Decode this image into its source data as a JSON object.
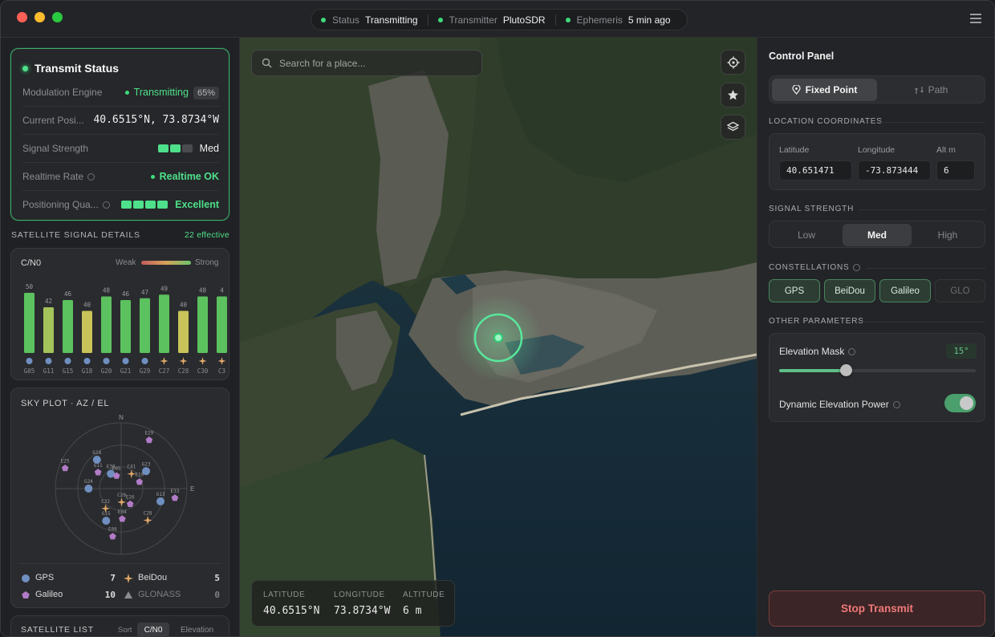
{
  "titlebar": {
    "status_label": "Status",
    "status_value": "Transmitting",
    "transmitter_label": "Transmitter",
    "transmitter_value": "PlutoSDR",
    "ephemeris_label": "Ephemeris",
    "ephemeris_value": "5 min ago"
  },
  "transmit": {
    "title": "Transmit Status",
    "modulation_label": "Modulation Engine",
    "modulation_value": "Transmitting",
    "modulation_progress": "65%",
    "position_label": "Current Posi...",
    "position_value": "40.6515°N, 73.8734°W",
    "signal_label": "Signal Strength",
    "signal_value": "Med",
    "signal_level": 2,
    "rate_label": "Realtime Rate",
    "rate_value": "Realtime OK",
    "quality_label": "Positioning Qua...",
    "quality_value": "Excellent",
    "quality_level": 4
  },
  "satellite_details": {
    "title": "SATELLITE SIGNAL DETAILS",
    "effective": "22 effective"
  },
  "cn0": {
    "title": "C/N0",
    "weak": "Weak",
    "strong": "Strong",
    "bars": [
      {
        "id": "G05",
        "value": 50,
        "label": "50",
        "sys": "gps"
      },
      {
        "id": "G11",
        "value": 42,
        "label": "42",
        "sys": "gps"
      },
      {
        "id": "G15",
        "value": 46,
        "label": "46",
        "sys": "gps"
      },
      {
        "id": "G18",
        "value": 40,
        "label": "40",
        "sys": "gps"
      },
      {
        "id": "G20",
        "value": 48,
        "label": "48",
        "sys": "gps"
      },
      {
        "id": "G21",
        "value": 46,
        "label": "46",
        "sys": "gps"
      },
      {
        "id": "G29",
        "value": 47,
        "label": "47",
        "sys": "gps"
      },
      {
        "id": "C27",
        "value": 49,
        "label": "49",
        "sys": "beidou"
      },
      {
        "id": "C28",
        "value": 40,
        "label": "40",
        "sys": "beidou"
      },
      {
        "id": "C30",
        "value": 48,
        "label": "48",
        "sys": "beidou"
      },
      {
        "id": "C3",
        "value": 48,
        "label": "4",
        "sys": "beidou"
      }
    ]
  },
  "skyplot": {
    "title": "SKY PLOT · AZ / EL",
    "north": "N",
    "east": "E",
    "sats": [
      {
        "id": "G18",
        "az": 320,
        "el": 45,
        "sys": "gps"
      },
      {
        "id": "E29",
        "az": 30,
        "el": 20,
        "sys": "galileo"
      },
      {
        "id": "G11",
        "az": 305,
        "el": 58,
        "sys": "galileo"
      },
      {
        "id": "E30",
        "az": 325,
        "el": 72,
        "sys": "gps"
      },
      {
        "id": "E05",
        "az": 340,
        "el": 78,
        "sys": "galileo"
      },
      {
        "id": "C41",
        "az": 35,
        "el": 72,
        "sys": "beidou"
      },
      {
        "id": "G23",
        "az": 55,
        "el": 55,
        "sys": "gps"
      },
      {
        "id": "E19",
        "az": 70,
        "el": 70,
        "sys": "galileo"
      },
      {
        "id": "E25",
        "az": 290,
        "el": 15,
        "sys": "galileo"
      },
      {
        "id": "G24",
        "az": 270,
        "el": 52,
        "sys": "gps"
      },
      {
        "id": "E33",
        "az": 100,
        "el": 22,
        "sys": "galileo"
      },
      {
        "id": "G13",
        "az": 108,
        "el": 40,
        "sys": "gps"
      },
      {
        "id": "C32",
        "az": 218,
        "el": 62,
        "sys": "beidou"
      },
      {
        "id": "C20",
        "az": 178,
        "el": 78,
        "sys": "beidou"
      },
      {
        "id": "E26",
        "az": 150,
        "el": 72,
        "sys": "galileo"
      },
      {
        "id": "G15",
        "az": 205,
        "el": 48,
        "sys": "gps"
      },
      {
        "id": "E04",
        "az": 178,
        "el": 55,
        "sys": "galileo"
      },
      {
        "id": "C28",
        "az": 140,
        "el": 40,
        "sys": "beidou"
      },
      {
        "id": "E06",
        "az": 190,
        "el": 30,
        "sys": "galileo"
      }
    ],
    "legend": [
      {
        "name": "GPS",
        "count": "7",
        "sys": "gps"
      },
      {
        "name": "BeiDou",
        "count": "5",
        "sys": "beidou"
      },
      {
        "name": "Galileo",
        "count": "10",
        "sys": "galileo"
      },
      {
        "name": "GLONASS",
        "count": "0",
        "sys": "glonass"
      }
    ]
  },
  "satellite_list": {
    "title": "SATELLITE LIST",
    "sort_label": "Sort",
    "sort_cn0": "C/N0",
    "sort_elevation": "Elevation"
  },
  "map": {
    "search_placeholder": "Search for a place...",
    "lat_label": "LATITUDE",
    "lat_value": "40.6515°N",
    "lon_label": "LONGITUDE",
    "lon_value": "73.8734°W",
    "alt_label": "ALTITUDE",
    "alt_value": "6 m"
  },
  "control": {
    "title": "Control Panel",
    "mode_fixed": "Fixed Point",
    "mode_path": "Path",
    "coords_heading": "LOCATION COORDINATES",
    "lat_label": "Latitude",
    "lat_value": "40.651471",
    "lon_label": "Longitude",
    "lon_value": "-73.873444",
    "alt_label": "Alt m",
    "alt_value": "6",
    "signal_heading": "SIGNAL STRENGTH",
    "signal_low": "Low",
    "signal_med": "Med",
    "signal_high": "High",
    "constellations_heading": "CONSTELLATIONS",
    "c_gps": "GPS",
    "c_beidou": "BeiDou",
    "c_galileo": "Galileo",
    "c_glo": "GLO",
    "other_heading": "OTHER PARAMETERS",
    "elev_mask_label": "Elevation Mask",
    "elev_mask_value": "15°",
    "elev_mask_fraction": 0.34,
    "dyn_power_label": "Dynamic Elevation Power",
    "dyn_power_on": true,
    "stop_label": "Stop Transmit"
  },
  "colors": {
    "accent_green": "#4ee08a",
    "gps": "#6f8fc0",
    "beidou": "#e0a86a",
    "galileo": "#b17bc7",
    "danger": "#f07979"
  }
}
